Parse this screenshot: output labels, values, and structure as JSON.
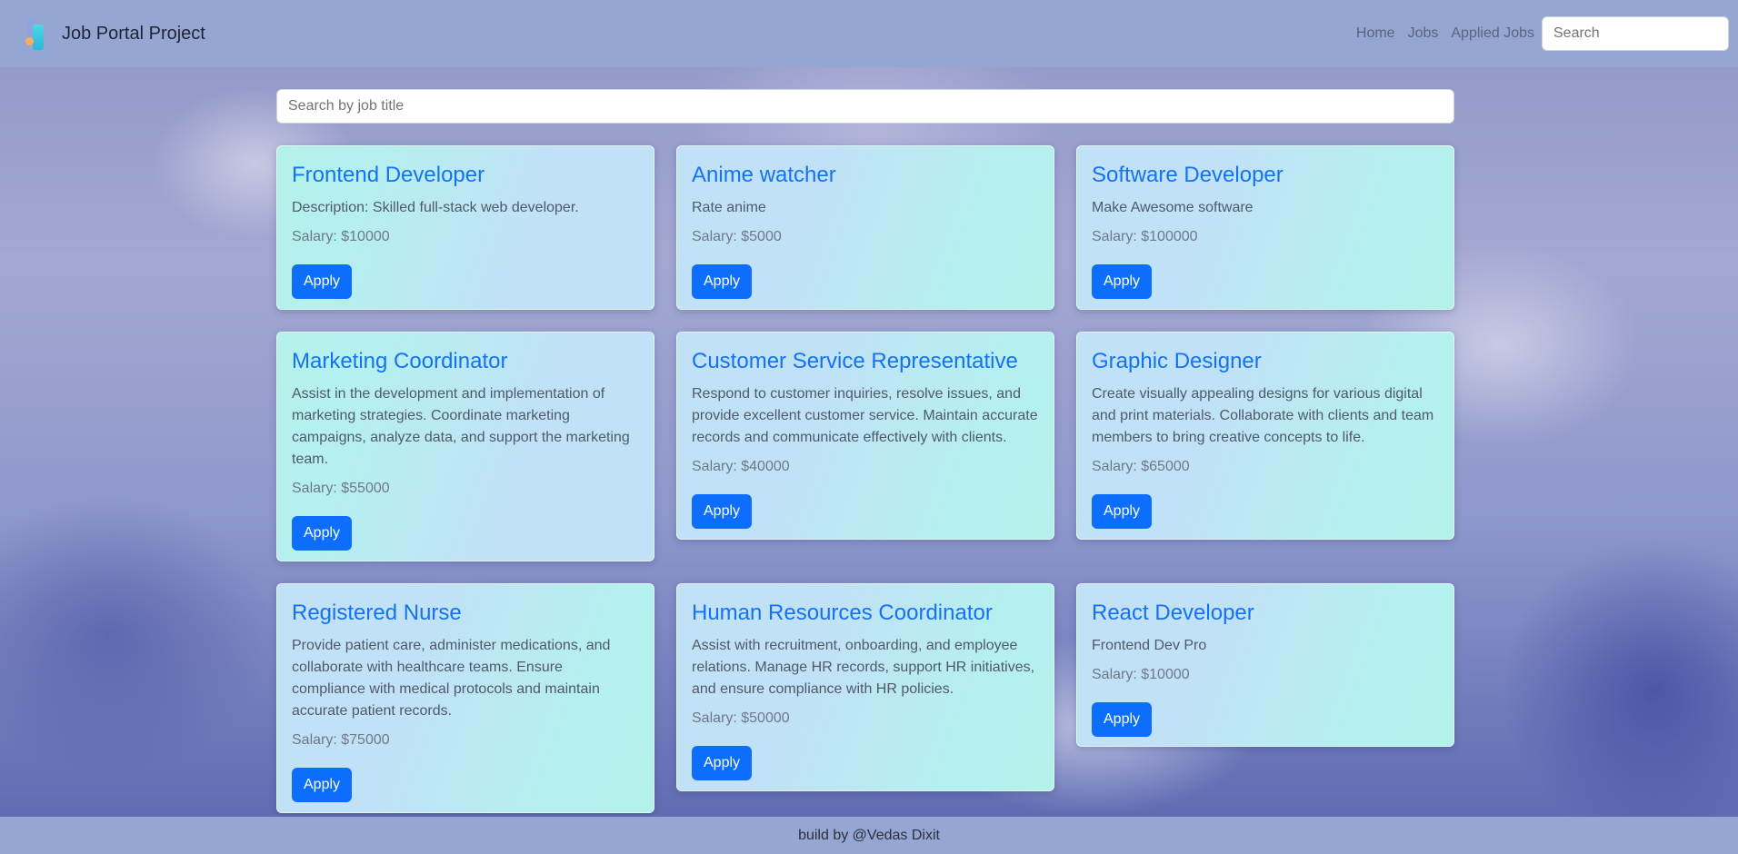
{
  "navbar": {
    "brand": "Job Portal Project",
    "links": [
      "Home",
      "Jobs",
      "Applied Jobs"
    ],
    "search_placeholder": "Search"
  },
  "search": {
    "placeholder": "Search by job title"
  },
  "jobs": [
    {
      "title": "Frontend Developer",
      "description": "Description: Skilled full-stack web developer.",
      "salary": "Salary: $10000",
      "apply": "Apply"
    },
    {
      "title": "Anime watcher",
      "description": "Rate anime",
      "salary": "Salary: $5000",
      "apply": "Apply"
    },
    {
      "title": "Software Developer",
      "description": "Make Awesome software",
      "salary": "Salary: $100000",
      "apply": "Apply"
    },
    {
      "title": "Marketing Coordinator",
      "description": "Assist in the development and implementation of marketing strategies. Coordinate marketing campaigns, analyze data, and support the marketing team.",
      "salary": "Salary: $55000",
      "apply": "Apply"
    },
    {
      "title": "Customer Service Representative",
      "description": "Respond to customer inquiries, resolve issues, and provide excellent customer service. Maintain accurate records and communicate effectively with clients.",
      "salary": "Salary: $40000",
      "apply": "Apply"
    },
    {
      "title": "Graphic Designer",
      "description": "Create visually appealing designs for various digital and print materials. Collaborate with clients and team members to bring creative concepts to life.",
      "salary": "Salary: $65000",
      "apply": "Apply"
    },
    {
      "title": "Registered Nurse",
      "description": "Provide patient care, administer medications, and collaborate with healthcare teams. Ensure compliance with medical protocols and maintain accurate patient records.",
      "salary": "Salary: $75000",
      "apply": "Apply"
    },
    {
      "title": "Human Resources Coordinator",
      "description": "Assist with recruitment, onboarding, and employee relations. Manage HR records, support HR initiatives, and ensure compliance with HR policies.",
      "salary": "Salary: $50000",
      "apply": "Apply"
    },
    {
      "title": "React Developer",
      "description": "Frontend Dev Pro",
      "salary": "Salary: $10000",
      "apply": "Apply"
    }
  ],
  "footer": {
    "text": "build by @Vedas Dixit"
  }
}
